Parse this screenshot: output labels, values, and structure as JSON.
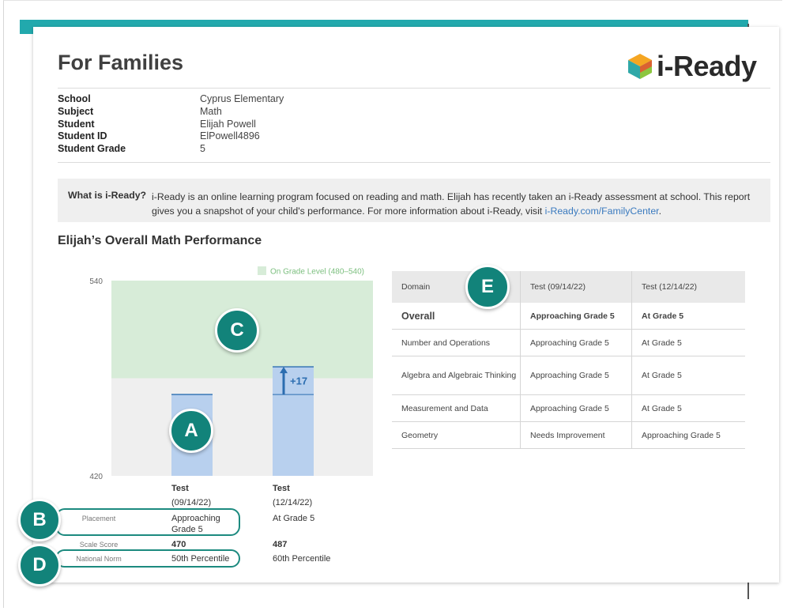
{
  "header": {
    "title": "For Families",
    "logo_text": "i-Ready"
  },
  "info": {
    "rows": [
      {
        "label": "School",
        "value": "Cyprus Elementary"
      },
      {
        "label": "Subject",
        "value": "Math"
      },
      {
        "label": "Student",
        "value": "Elijah Powell"
      },
      {
        "label": "Student ID",
        "value": "ElPowell4896"
      },
      {
        "label": "Student Grade",
        "value": "5"
      }
    ]
  },
  "whatis": {
    "question": "What is i-Ready?",
    "text": "i-Ready is an online learning program focused on reading and math. Elijah has recently taken an i-Ready assessment at school. This report gives you a snapshot of your child's performance. For more information about i-Ready, visit ",
    "link": "i-Ready.com/FamilyCenter",
    "end": "."
  },
  "section_title": "Elijah’s Overall Math Performance",
  "badges": {
    "a": "A",
    "b": "B",
    "c": "C",
    "d": "D",
    "e": "E"
  },
  "colors": {
    "teal": "#22a9ad",
    "badge": "#12837a",
    "band": "#d7ecd8",
    "below_band": "#efefef",
    "bar": "#b8d0ee",
    "arrow": "#2b6db0",
    "link": "#3a7abf"
  },
  "chart_data": {
    "type": "bar",
    "categories": [
      "Test\n(09/14/22)",
      "Test\n(12/14/22)"
    ],
    "values": [
      470,
      487
    ],
    "ylim": [
      420,
      540
    ],
    "yticks": [
      420,
      540
    ],
    "band": {
      "label": "On Grade Level (480–540)",
      "from": 480,
      "to": 540
    },
    "annotation": "+17",
    "grid": false,
    "legend": "top-right"
  },
  "chart_table": {
    "tests": [
      {
        "label": "Test",
        "date": "(09/14/22)",
        "placement": "Approaching Grade 5",
        "scale": "470",
        "norm": "50th Percentile"
      },
      {
        "label": "Test",
        "date": "(12/14/22)",
        "placement": "At Grade 5",
        "scale": "487",
        "norm": "60th Percentile"
      }
    ],
    "row_labels": {
      "placement": "Placement",
      "scale": "Scale Score",
      "norm": "National Norm"
    }
  },
  "domains": {
    "headers": [
      "Domain",
      "Test (09/14/22)",
      "Test (12/14/22)"
    ],
    "rows": [
      [
        "Overall",
        "Approaching Grade 5",
        "At Grade 5"
      ],
      [
        "Number and Operations",
        "Approaching Grade 5",
        "At Grade 5"
      ],
      [
        "Algebra and Algebraic Thinking",
        "Approaching Grade 5",
        "At Grade 5"
      ],
      [
        "Measurement and Data",
        "Approaching Grade 5",
        "At Grade 5"
      ],
      [
        "Geometry",
        "Needs Improvement",
        "Approaching Grade 5"
      ]
    ]
  }
}
